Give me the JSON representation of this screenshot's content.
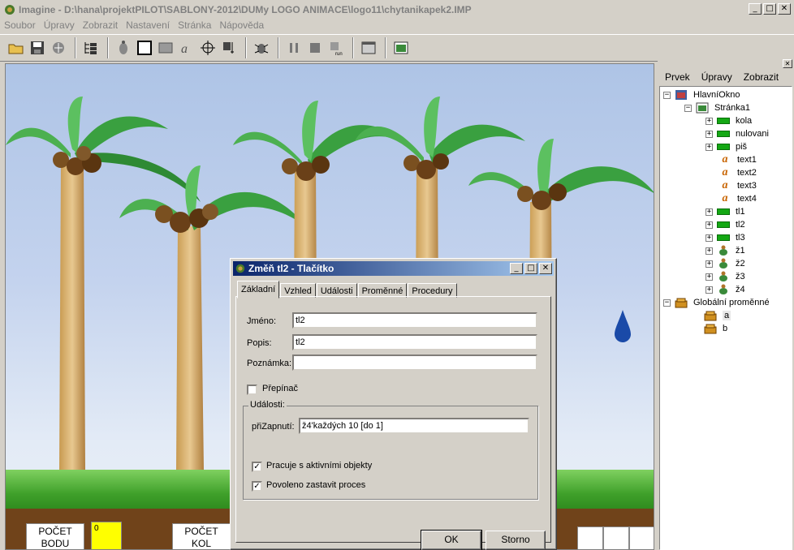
{
  "window": {
    "title": "Imagine - D:\\hana\\projektPILOT\\SABLONY-2012\\DUMy LOGO ANIMACE\\logo11\\chytanikapek2.IMP"
  },
  "menubar": [
    "Soubor",
    "Úpravy",
    "Zobrazit",
    "Nastavení",
    "Stránka",
    "Nápověda"
  ],
  "toolbar": {
    "icons": [
      "open-icon",
      "save-icon",
      "network-icon",
      "tree-view-icon",
      "turtle-icon",
      "frame-icon",
      "rectangle-icon",
      "text-tool-icon",
      "slider-tool-icon",
      "stamp-tool-icon",
      "debug-icon",
      "pause-icon",
      "stop-icon",
      "run-icon",
      "window-icon",
      "page-icon"
    ]
  },
  "canvas": {
    "score_label": [
      "POČET",
      "BODU"
    ],
    "score_value": "0",
    "rounds_label": [
      "POČET",
      "KOL"
    ]
  },
  "right_panel": {
    "menu": [
      "Prvek",
      "Úpravy",
      "Zobrazit"
    ],
    "tree": {
      "root": "HlavníOkno",
      "page": "Stránka1",
      "items": [
        {
          "label": "kola",
          "kind": "button"
        },
        {
          "label": "nulovani",
          "kind": "button"
        },
        {
          "label": "piš",
          "kind": "button"
        },
        {
          "label": "text1",
          "kind": "text"
        },
        {
          "label": "text2",
          "kind": "text"
        },
        {
          "label": "text3",
          "kind": "text"
        },
        {
          "label": "text4",
          "kind": "text"
        },
        {
          "label": "tl1",
          "kind": "button"
        },
        {
          "label": "tl2",
          "kind": "button"
        },
        {
          "label": "tl3",
          "kind": "button"
        },
        {
          "label": "ž1",
          "kind": "turtle"
        },
        {
          "label": "ž2",
          "kind": "turtle"
        },
        {
          "label": "ž3",
          "kind": "turtle"
        },
        {
          "label": "ž4",
          "kind": "turtle"
        }
      ],
      "globals_label": "Globální proměnné",
      "globals": [
        "a",
        "b"
      ]
    }
  },
  "dialog": {
    "title": "Změň tl2 - Tlačítko",
    "tabs": [
      "Základní",
      "Vzhled",
      "Události",
      "Proměnné",
      "Procedury"
    ],
    "active_tab": "Základní",
    "name_label": "Jméno:",
    "name_value": "tl2",
    "desc_label": "Popis:",
    "desc_value": "tl2",
    "note_label": "Poznámka:",
    "note_value": "",
    "toggle_label": "Přepínač",
    "toggle_checked": false,
    "events_group": "Události:",
    "on_press_label": "přiZapnutí:",
    "on_press_value": "ž4'každých 10 [do 1]",
    "active_objects_label": "Pracuje s aktivními objekty",
    "active_objects_checked": true,
    "allow_stop_label": "Povoleno zastavit proces",
    "allow_stop_checked": true,
    "ok_label": "OK",
    "cancel_label": "Storno"
  }
}
